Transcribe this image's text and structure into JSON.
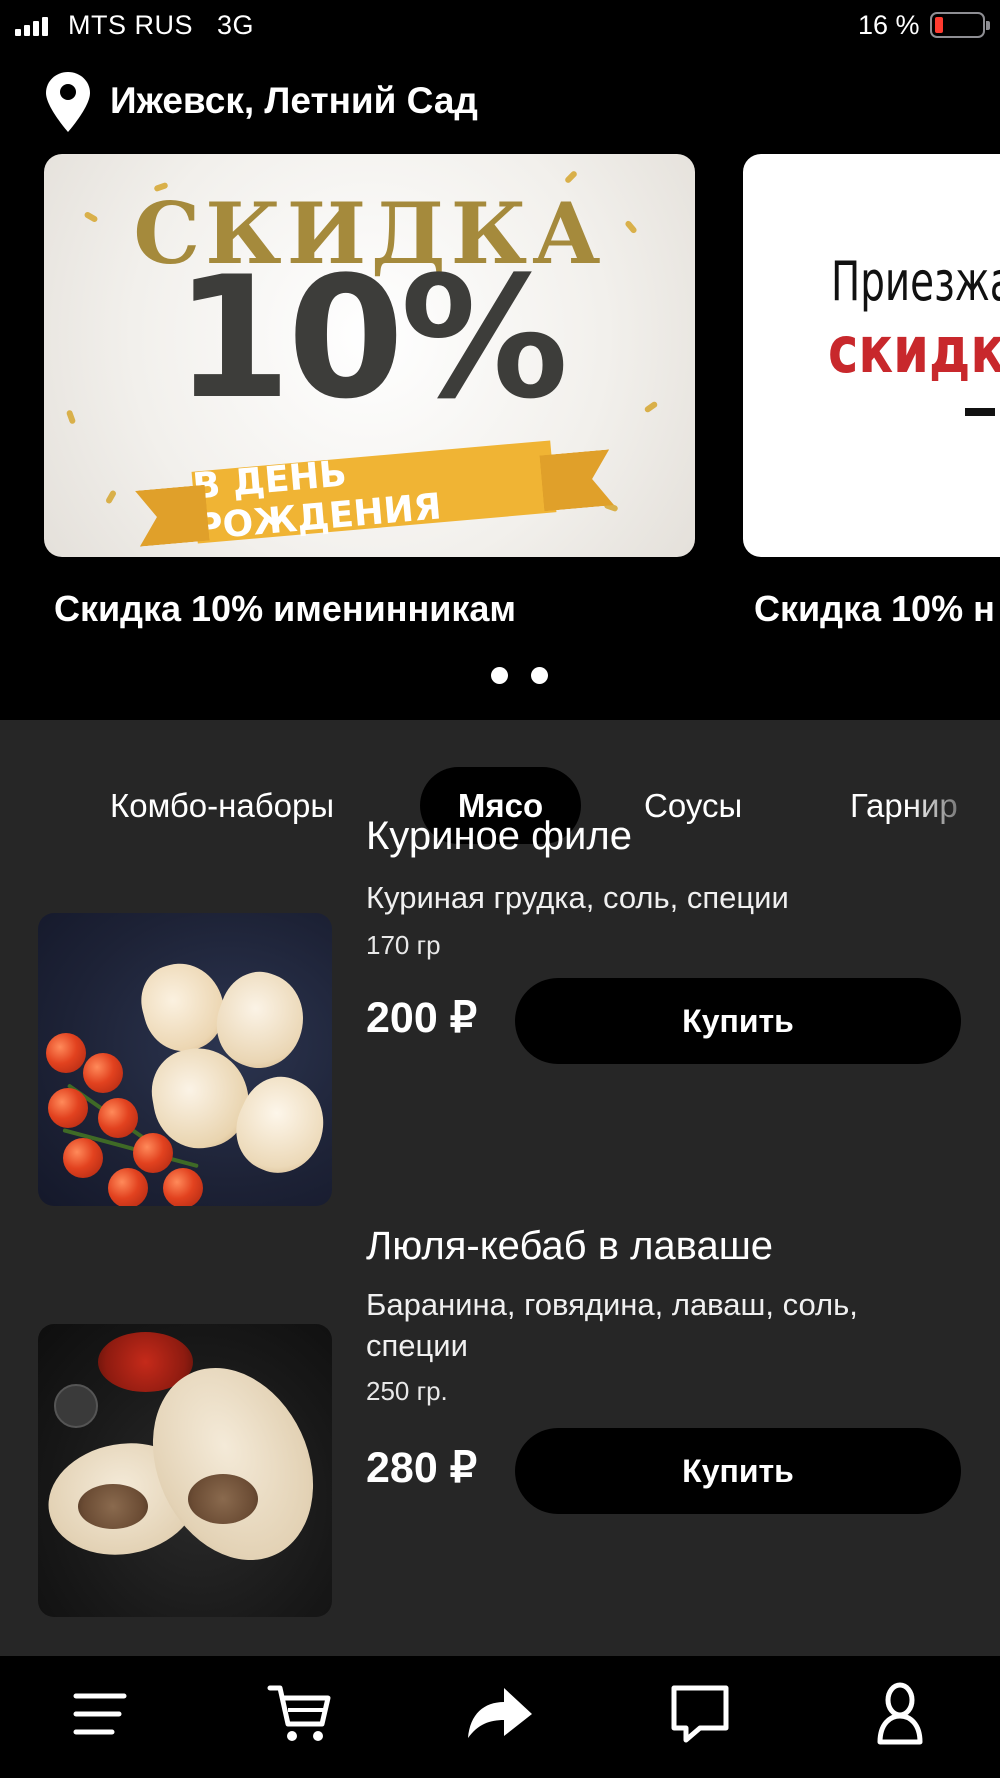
{
  "status_bar": {
    "carrier": "MTS RUS",
    "network": "3G",
    "battery_percent": "16 %",
    "battery_level": 0.16,
    "icons": [
      "signal-bars-icon",
      "battery-low-icon"
    ]
  },
  "location": {
    "icon": "location-pin-icon",
    "title": "Ижевск, Летний Сад"
  },
  "banners": [
    {
      "caption": "Скидка 10% именинникам",
      "text_top": "СКИДКА",
      "text_big": "10%",
      "ribbon": "В ДЕНЬ РОЖДЕНИЯ"
    },
    {
      "caption": "Скидка 10% н",
      "line1": "Приезжай",
      "line2": "скидка"
    }
  ],
  "carousel": {
    "total_pages": 2,
    "active_page": 1
  },
  "category_tabs": [
    {
      "label": "Комбо-наборы",
      "active": false
    },
    {
      "label": "Мясо",
      "active": true
    },
    {
      "label": "Соусы",
      "active": false
    },
    {
      "label": "Гарнир",
      "active": false
    }
  ],
  "products": [
    {
      "name": "Куриное филе",
      "description": "Куриная грудка, соль, специи",
      "weight": "170 гр",
      "price": "200 ₽",
      "buy_label": "Купить"
    },
    {
      "name": "Люля-кебаб в лаваше",
      "description": "Баранина, говядина, лаваш, соль, специи",
      "weight": "250 гр.",
      "price": "280 ₽",
      "buy_label": "Купить"
    }
  ],
  "bottom_nav": {
    "icons": [
      "menu-icon",
      "cart-icon",
      "share-icon",
      "chat-icon",
      "profile-icon"
    ]
  },
  "colors": {
    "background": "#000000",
    "menu_background": "#262626",
    "button": "#000000",
    "text": "#ffffff",
    "banner_gold": "#f0b434",
    "banner_red": "#c8282c",
    "battery_low": "#ff3b30"
  }
}
